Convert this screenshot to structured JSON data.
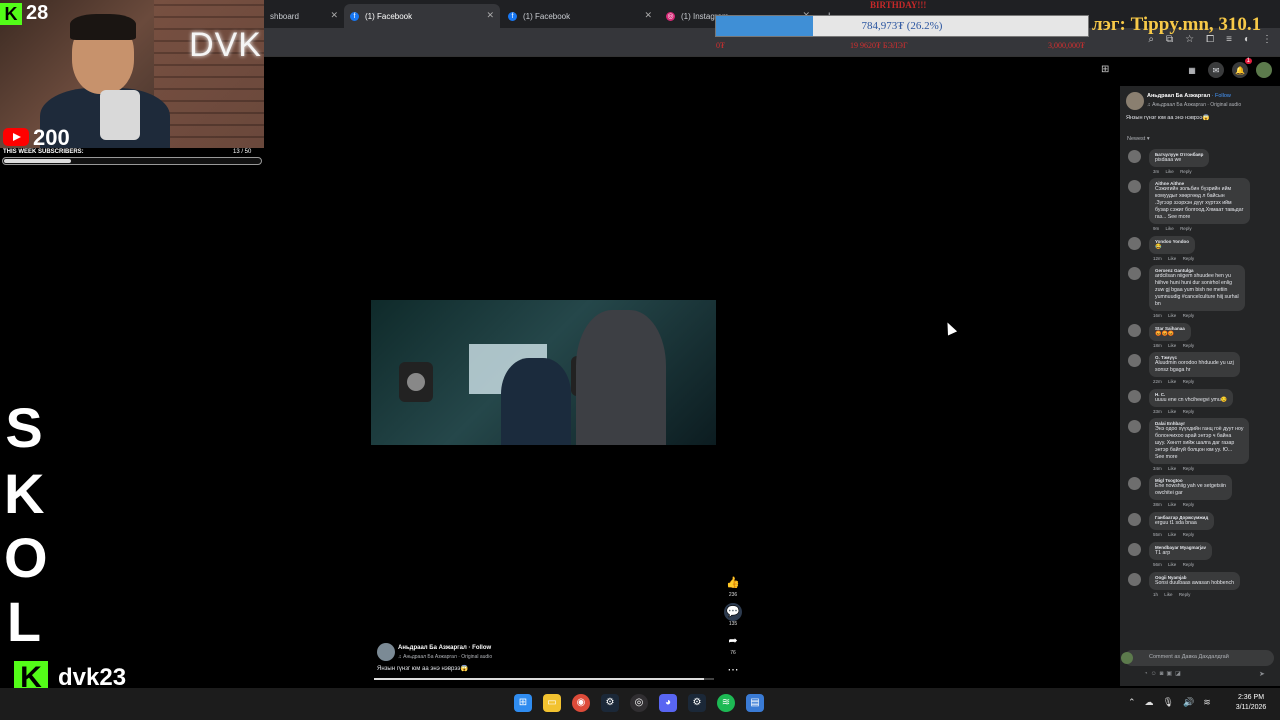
{
  "browser": {
    "tabs": [
      {
        "label": "shboard",
        "favicon": "dashboard-icon"
      },
      {
        "label": "(1) Facebook",
        "favicon": "facebook-icon",
        "active": true
      },
      {
        "label": "(1) Facebook",
        "favicon": "facebook-icon"
      },
      {
        "label": "(1) Instagram",
        "favicon": "instagram-icon"
      }
    ],
    "new_tab": "+"
  },
  "overlay": {
    "birthday": "BIRTHDAY!!!",
    "donation_text": "784,973₮ (26.2%)",
    "donation_progress": 0.262,
    "tippy": "лэг: Tippy.mn, 310.1",
    "red_left": "0₮",
    "red_mid": "19 9620₮ БЭЛЭГ",
    "red_right": "3,000,000₮"
  },
  "webcam": {
    "brand": "DVK",
    "kick_followers": "28",
    "yt_subscribers": "200",
    "subs_label": "THIS WEEK SUBSCRIBERS:",
    "subs_progress_text": "13  / 50",
    "subs_progress": 0.26
  },
  "stream_letters": [
    "S",
    "K",
    "O",
    "L"
  ],
  "channel_name": "dvk23",
  "video": {
    "likes": "236",
    "comments": "135",
    "shares": "76",
    "author": "Аньдраал Ба Азжаргал",
    "follow": "· Follow",
    "audio": "♫ Аньдраал Ба Азжаргал · Original audio",
    "caption": "Янзын гүнзг юм аа энэ нэврээ😱",
    "progress": 0.97
  },
  "panel": {
    "author": "Аньдраал Ба Азжаргал",
    "follow": "· Follow",
    "audio": "♫ Аньдраал Ба Азжаргал · Original audio",
    "caption": "Янзын гүнзг юм аа энэ нэврээ😱",
    "sort": "Newest ▾",
    "comments": [
      {
        "name": "Батчулуун Отгонбаяр",
        "text": "pisdaaa we",
        "time": "3m"
      },
      {
        "name": "Aithne Aithne",
        "text": "Сэжигийн зольбин бүзрийн ийм\nкомуудыг хөөргөөд л байсын\n.Зугээр зээрхэн дүүг хүртэх ийм\nбузар сэжиг болгоод.Хямаат тавьдаг\nгаз... See more",
        "time": "9m"
      },
      {
        "name": "Yondoo Yondoo",
        "text": "😂",
        "time": "12m"
      },
      {
        "name": "Gerxenz Gantulga",
        "text": "ardcilsan niigem shuudee hen yu\nhiihve huni huni dur sonirhol enlig\nzuw gj bgaa yum bish ne metiin\nyumnuudig #cancelculture hiij surhal\nbn",
        "time": "16m"
      },
      {
        "name": "Star Saihanaa",
        "text": "😡😡😡",
        "time": "18m"
      },
      {
        "name": "О. Тэмүүс",
        "text": "Aluudmin oorodoo hhduude yu uzj\nsonsz bgaga hr",
        "time": "22m"
      },
      {
        "name": "H. C.",
        "text": "uuuu ene cn vhciheegvi ymu😏",
        "time": "33m"
      },
      {
        "name": "Dalai Enhbayr",
        "text": "Энэ одоо хүүхдийн ганц гоё дуут ноу\nболончихоо арай энтэр ч байна\nшуу. Хөнлт хийж шалга даг газар\nэнтэр байгүй болцон юм уу. Ю...\nSee more",
        "time": "34m"
      },
      {
        "name": "Migl Tsogtoo",
        "text": "Ene nowshiig yah ve setgetsiin\nowchitei gar",
        "time": "38m"
      },
      {
        "name": "Ганбаатар Доржсүмжид",
        "text": "erguu t1 sda bnaa",
        "time": "55m"
      },
      {
        "name": "Mendbayar Myagmarjav",
        "text": "T1 агр",
        "time": "56m"
      },
      {
        "name": "Oogii Nyamjab",
        "text": "Sonsi duulbaas awasan hobbench",
        "time": "1h"
      }
    ],
    "like_label": "Like",
    "reply_label": "Reply",
    "comment_placeholder": "Comment as Давка Дахдалдгай"
  },
  "taskbar": {
    "apps": [
      "windows-start-icon",
      "file-explorer-icon",
      "chrome-icon",
      "steam-icon",
      "obs-icon",
      "discord-icon",
      "steam-icon",
      "spotify-icon",
      "notepad-icon"
    ],
    "time": "2:36 PM",
    "date": "3/11/2026"
  },
  "colors": {
    "accent_fb": "#4599ff",
    "kick_green": "#53fc18",
    "donation_blue": "#3f8fd6"
  }
}
